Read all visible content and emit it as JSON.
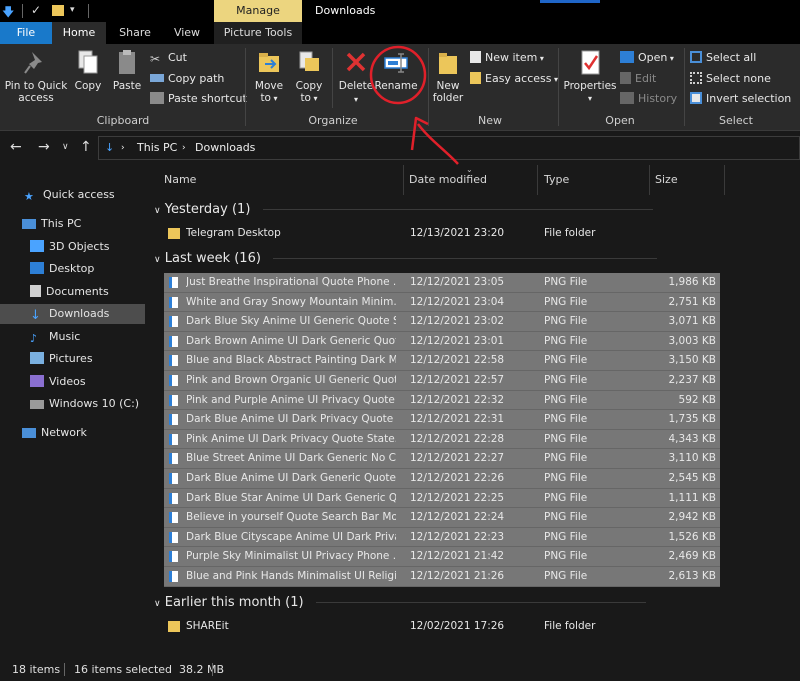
{
  "titlebar": {
    "manage_label": "Manage",
    "window_title": "Downloads"
  },
  "tabs": {
    "file": "File",
    "home": "Home",
    "share": "Share",
    "view": "View",
    "picture_tools": "Picture Tools"
  },
  "ribbon": {
    "clipboard": {
      "pin_line1": "Pin to Quick",
      "pin_line2": "access",
      "copy": "Copy",
      "paste": "Paste",
      "cut": "Cut",
      "copy_path": "Copy path",
      "paste_shortcut": "Paste shortcut",
      "group_label": "Clipboard"
    },
    "organize": {
      "move_line1": "Move",
      "move_line2": "to",
      "copy_line1": "Copy",
      "copy_line2": "to",
      "delete": "Delete",
      "rename": "Rename",
      "group_label": "Organize"
    },
    "new": {
      "new_folder_line1": "New",
      "new_folder_line2": "folder",
      "new_item": "New item",
      "easy_access": "Easy access",
      "group_label": "New"
    },
    "open": {
      "properties": "Properties",
      "open": "Open",
      "edit": "Edit",
      "history": "History",
      "group_label": "Open"
    },
    "select": {
      "select_all": "Select all",
      "select_none": "Select none",
      "invert_selection": "Invert selection",
      "group_label": "Select"
    }
  },
  "address": {
    "crumb1": "This PC",
    "crumb2": "Downloads"
  },
  "sidebar": {
    "quick_access": "Quick access",
    "this_pc": "This PC",
    "objects_3d": "3D Objects",
    "desktop": "Desktop",
    "documents": "Documents",
    "downloads": "Downloads",
    "music": "Music",
    "pictures": "Pictures",
    "videos": "Videos",
    "windows_c": "Windows 10 (C:)",
    "network": "Network"
  },
  "columns": {
    "name": "Name",
    "date_modified": "Date modified",
    "type": "Type",
    "size": "Size"
  },
  "groups": {
    "yesterday": "Yesterday (1)",
    "last_week": "Last week (16)",
    "earlier_month": "Earlier this month (1)"
  },
  "files": {
    "yesterday": [
      {
        "name": "Telegram Desktop",
        "date": "12/13/2021 23:20",
        "type": "File folder",
        "size": ""
      }
    ],
    "last_week": [
      {
        "name": "Just Breathe Inspirational Quote Phone ...",
        "date": "12/12/2021 23:05",
        "type": "PNG File",
        "size": "1,986 KB"
      },
      {
        "name": "White and Gray Snowy Mountain Minim...",
        "date": "12/12/2021 23:04",
        "type": "PNG File",
        "size": "2,751 KB"
      },
      {
        "name": "Dark Blue Sky Anime UI Generic Quote  S...",
        "date": "12/12/2021 23:02",
        "type": "PNG File",
        "size": "3,071 KB"
      },
      {
        "name": "Dark Brown Anime UI Dark Generic Quot...",
        "date": "12/12/2021 23:01",
        "type": "PNG File",
        "size": "3,003 KB"
      },
      {
        "name": "Blue and Black Abstract Painting Dark Mi...",
        "date": "12/12/2021 22:58",
        "type": "PNG File",
        "size": "3,150 KB"
      },
      {
        "name": "Pink and Brown Organic UI Generic Quot...",
        "date": "12/12/2021 22:57",
        "type": "PNG File",
        "size": "2,237 KB"
      },
      {
        "name": "Pink and Purple Anime UI Privacy Quote ...",
        "date": "12/12/2021 22:32",
        "type": "PNG File",
        "size": "592 KB"
      },
      {
        "name": "Dark Blue Anime UI Dark Privacy Quote ...",
        "date": "12/12/2021 22:31",
        "type": "PNG File",
        "size": "1,735 KB"
      },
      {
        "name": "Pink Anime UI Dark Privacy Quote  State...",
        "date": "12/12/2021 22:28",
        "type": "PNG File",
        "size": "4,343 KB"
      },
      {
        "name": "Blue Street Anime UI Dark Generic No Co...",
        "date": "12/12/2021 22:27",
        "type": "PNG File",
        "size": "3,110 KB"
      },
      {
        "name": "Dark Blue Anime UI Dark Generic Quote ...",
        "date": "12/12/2021 22:26",
        "type": "PNG File",
        "size": "2,545 KB"
      },
      {
        "name": "Dark Blue Star Anime UI Dark Generic Qu...",
        "date": "12/12/2021 22:25",
        "type": "PNG File",
        "size": "1,111 KB"
      },
      {
        "name": "Believe in yourself Quote Search Bar Moti...",
        "date": "12/12/2021 22:24",
        "type": "PNG File",
        "size": "2,942 KB"
      },
      {
        "name": "Dark Blue Cityscape Anime UI Dark Priva...",
        "date": "12/12/2021 22:23",
        "type": "PNG File",
        "size": "1,526 KB"
      },
      {
        "name": "Purple Sky Minimalist UI Privacy Phone ...",
        "date": "12/12/2021 21:42",
        "type": "PNG File",
        "size": "2,469 KB"
      },
      {
        "name": "Blue and Pink Hands Minimalist UI Religi...",
        "date": "12/12/2021 21:26",
        "type": "PNG File",
        "size": "2,613 KB"
      }
    ],
    "earlier_month": [
      {
        "name": "SHAREit",
        "date": "12/02/2021 17:26",
        "type": "File folder",
        "size": ""
      }
    ]
  },
  "status": {
    "item_count": "18 items",
    "selection": "16 items selected  38.2 MB"
  },
  "colors": {
    "accent": "#1979ca",
    "manage_tab": "#ecd57f",
    "selection": "#777777",
    "background": "#191919",
    "annotation": "#e0202a"
  },
  "icons": [
    "pin-icon",
    "copy-icon",
    "paste-icon",
    "scissors-icon",
    "copy-path-icon",
    "paste-shortcut-icon",
    "move-to-icon",
    "copy-to-icon",
    "delete-icon",
    "rename-icon",
    "new-folder-icon",
    "new-item-icon",
    "easy-access-icon",
    "properties-icon",
    "open-icon",
    "edit-icon",
    "history-icon",
    "select-all-icon",
    "select-none-icon",
    "invert-selection-icon",
    "folder-icon",
    "png-file-icon",
    "back-arrow-icon",
    "forward-arrow-icon",
    "up-arrow-icon",
    "star-icon",
    "pc-icon",
    "network-icon"
  ]
}
